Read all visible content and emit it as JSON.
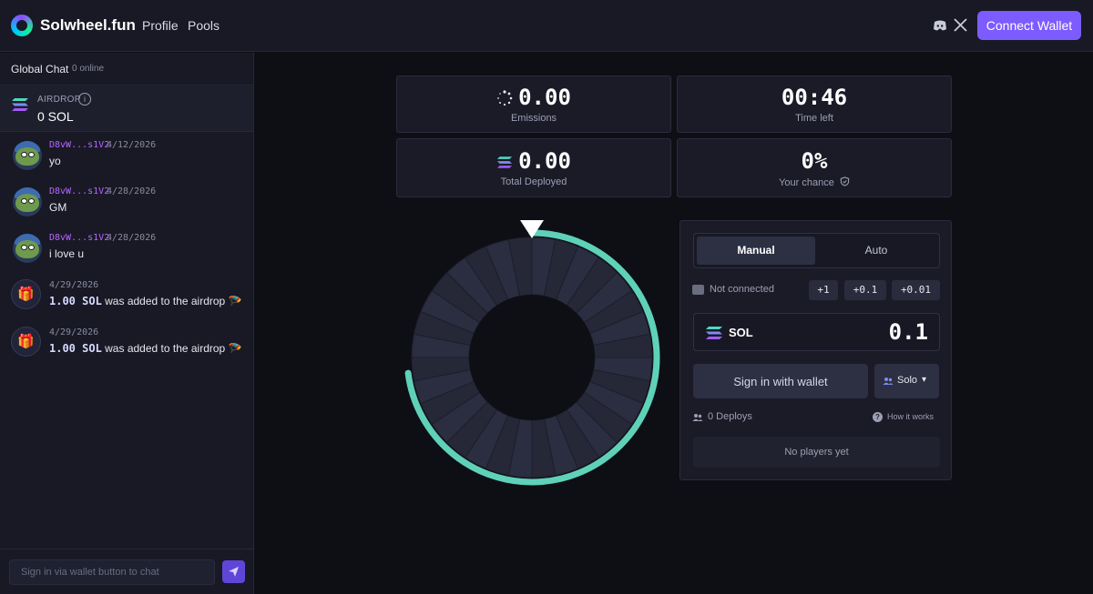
{
  "header": {
    "brand": "Solwheel.fun",
    "nav": [
      "Profile",
      "Pools"
    ],
    "connect_label": "Connect Wallet",
    "icons": [
      "discord-icon",
      "x-icon"
    ]
  },
  "sidebar": {
    "chat_title": "Global Chat",
    "online": "0 online",
    "airdrop_label": "AIRDROP",
    "airdrop_value": "0 SOL",
    "messages": [
      {
        "user": "D8vW...s1V2",
        "date": "4/12/2026",
        "text": "yo"
      },
      {
        "user": "D8vW...s1V2",
        "date": "4/28/2026",
        "text": "GM"
      },
      {
        "user": "D8vW...s1V2",
        "date": "4/28/2026",
        "text": "i love u"
      }
    ],
    "system_messages": [
      {
        "date": "4/29/2026",
        "amount": "1.00 SOL",
        "text": "was added to the airdrop 🪂"
      },
      {
        "date": "4/29/2026",
        "amount": "1.00 SOL",
        "text": "was added to the airdrop 🪂"
      }
    ],
    "chat_placeholder": "Sign in via wallet button to chat"
  },
  "stats": {
    "emissions_value": "0.00",
    "emissions_label": "Emissions",
    "time_value": "00:46",
    "time_label": "Time left",
    "deployed_value": "0.00",
    "deployed_label": "Total Deployed",
    "chance_value": "0%",
    "chance_label": "Your chance"
  },
  "wheel": {
    "segments": 32,
    "progress_fraction": 0.73,
    "colors": {
      "progress": "#5fd1b9",
      "segment_a": "#262838",
      "segment_b": "#2b2d41",
      "hub": "#0e0f15"
    }
  },
  "panel": {
    "tab_manual": "Manual",
    "tab_auto": "Auto",
    "status": "Not connected",
    "increments": [
      "+1",
      "+0.1",
      "+0.01"
    ],
    "currency": "SOL",
    "amount": "0.1",
    "signin_label": "Sign in with wallet",
    "mode_label": "Solo",
    "deploys": "0 Deploys",
    "how_label": "How it works",
    "no_players": "No players yet"
  },
  "colors": {
    "accent": "#7c5cff",
    "username": "#b866ff",
    "teal": "#5fd1b9"
  }
}
